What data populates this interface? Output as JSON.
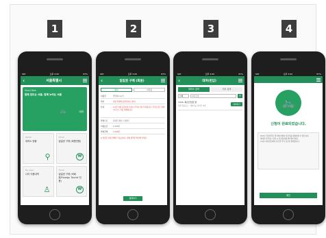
{
  "steps": [
    "1",
    "2",
    "3",
    "4"
  ],
  "status": {
    "carrier": "SKT",
    "time": "오후 3:00",
    "battery": "87%"
  },
  "screen1": {
    "logo": "서울특별시",
    "banner_small": "Seoul Bike",
    "banner_title": "함께 만드는 서울, 함께 누리는 서울",
    "banner_button": "대여",
    "tiles": [
      {
        "small": "Rental",
        "label": "대여소 현황",
        "icon": "search-icon",
        "glyph": "⚲"
      },
      {
        "small": "Ticket",
        "label": "일일권 구매 (회원전용)",
        "icon": "won-icon",
        "glyph": "₩"
      },
      {
        "small": "My page",
        "label": "나의 이용내역",
        "icon": "user-icon",
        "glyph": "♙"
      },
      {
        "small": "Ticket",
        "label": "일일권 구매 (비회원/Foreign Tourist 전용)",
        "icon": "won-icon",
        "glyph": "₩"
      }
    ]
  },
  "screen2": {
    "title": "일일권 구매 (회원)",
    "tabs": [
      "일반",
      "비회원"
    ],
    "rows": [
      {
        "label": "이용권",
        "value": "일일권(1시간)"
      },
      {
        "label": "약관",
        "value": "이용 약관에 동의합니다 (필수)",
        "red": true
      },
      {
        "label": "안내",
        "value": "1시간 이용 기준이며 초과시 추가요금이 부과됩니다. 추가요금은 결제 수단으로 자동 결제됩니다.",
        "red": true
      },
      {
        "label": "결제수단",
        "value": "휴대폰 결제 / 신용카드"
      },
      {
        "label": "이용요금",
        "value": "1,000원"
      },
      {
        "label": "결제금액",
        "value": "1,000원",
        "red": true
      }
    ],
    "note": "※ 환불은 이용 전에만 가능합니다. 결제 내역을 확인해 주세요.",
    "button": "결제하기"
  },
  "screen3": {
    "title": "대여(반납)",
    "tabs": [
      "대여소 검색",
      "지도 검색"
    ],
    "select": "전체",
    "input": "대여소명",
    "result_title": "1024. 목산진입로 앞",
    "result_sub": "서울 영등포구 · 대여가능 자전거 4대",
    "result_button": "대여하기"
  },
  "screen4": {
    "done": "신청이 완료되었습니다.",
    "info": [
      "1024. 목산진입로 앞 대여소에서 자전거를 대여하실 수 있습니다.",
      "대여한 자전거는 반납 시 잠금장치를 확인해 주세요.",
      "2시간 이내 반납하지 않으면 추가 요금이 발생합니다."
    ],
    "button": "확인"
  },
  "colors": {
    "accent": "#23905a",
    "banner": "#27a161",
    "phone": "#1e1e1e",
    "step": "#3d3d3d"
  }
}
